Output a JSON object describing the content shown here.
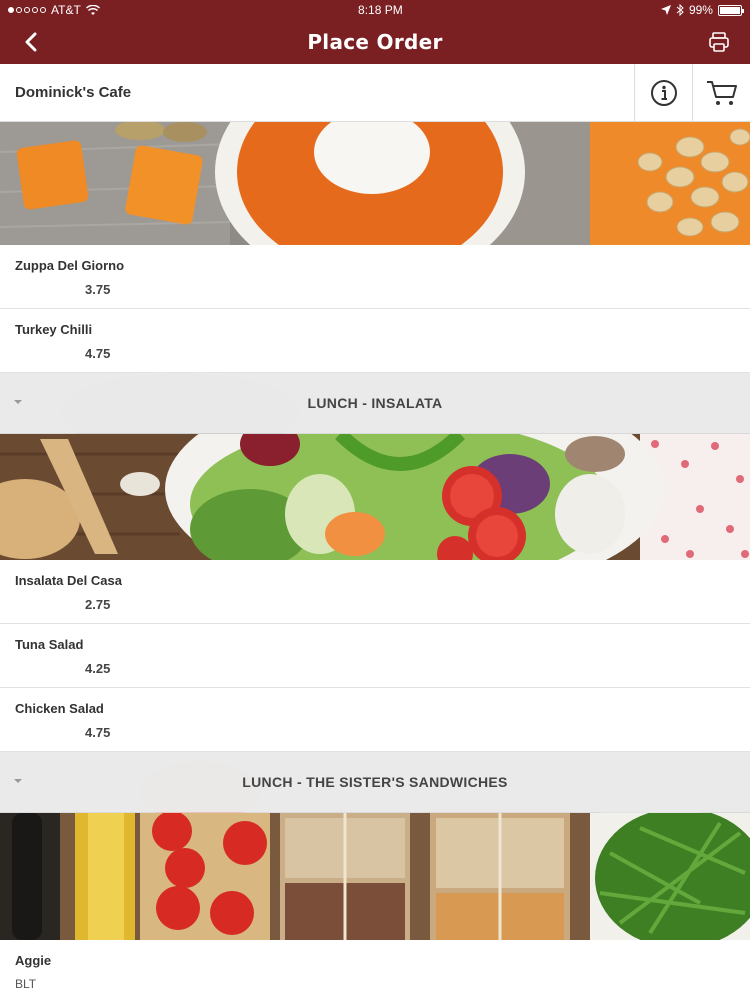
{
  "status_bar": {
    "carrier": "AT&T",
    "time": "8:18 PM",
    "battery": "99%",
    "battery_level": 0.99,
    "signal_bars_filled": 1,
    "signal_bars_total": 5
  },
  "nav": {
    "title": "Place Order",
    "back_icon": "chevron-left-icon",
    "print_icon": "printer-icon"
  },
  "restaurant": {
    "name": "Dominick's Cafe",
    "info_icon": "info-icon",
    "cart_icon": "cart-icon"
  },
  "soup_items": [
    {
      "name": "Zuppa Del Giorno",
      "price": "3.75"
    },
    {
      "name": "Turkey Chilli",
      "price": "4.75"
    }
  ],
  "sections": [
    {
      "label": "LUNCH - INSALATA"
    },
    {
      "label": "LUNCH - THE SISTER'S SANDWICHES"
    }
  ],
  "salad_items": [
    {
      "name": "Insalata Del Casa",
      "price": "2.75"
    },
    {
      "name": "Tuna Salad",
      "price": "4.25"
    },
    {
      "name": "Chicken Salad",
      "price": "4.75"
    }
  ],
  "sandwich_items": [
    {
      "name": "Aggie",
      "description": "BLT"
    }
  ],
  "colors": {
    "brand": "#7a1f22",
    "section_bg": "#ebebeb"
  }
}
